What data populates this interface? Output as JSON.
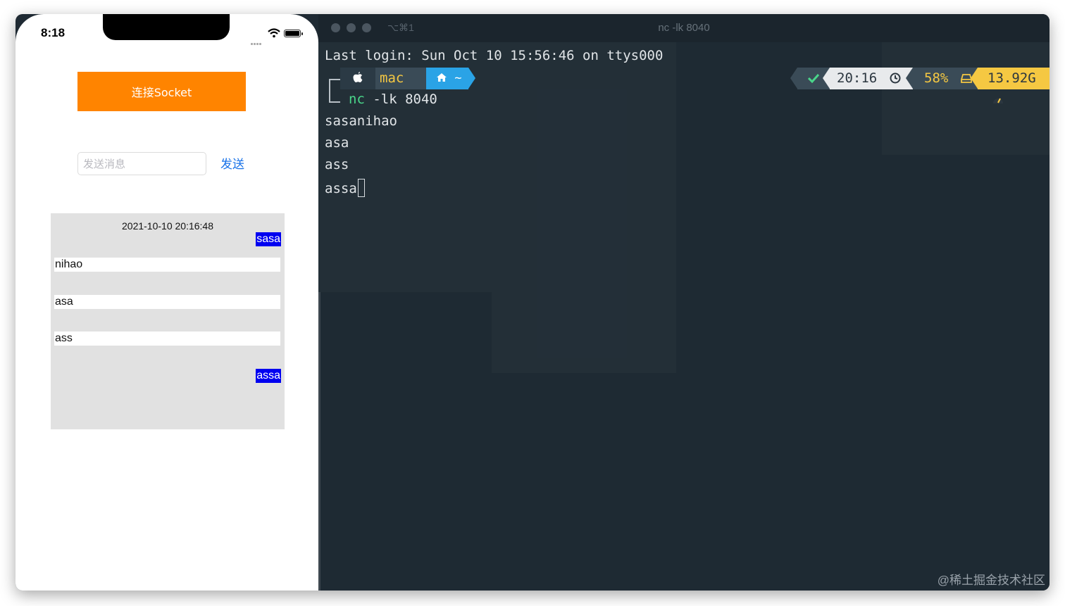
{
  "terminal": {
    "shortcut": "⌥⌘1",
    "title": "nc -lk 8040",
    "last_login": "Last login: Sun Oct 10 15:56:46 on ttys000",
    "prompt": {
      "user_segment": "mac",
      "dir_segment": "~",
      "cmd_name": "nc",
      "cmd_args": " -lk 8040"
    },
    "status": {
      "time": "20:16",
      "battery": "58%",
      "memory": "13.92G"
    },
    "output_lines": [
      "sasanihao",
      "asa",
      "ass"
    ],
    "current_line": "assa",
    "colors": {
      "background": "#1e2a33",
      "accent_yellow": "#f5c842",
      "accent_blue": "#2aa3e6",
      "accent_green": "#4ad68a"
    }
  },
  "phone": {
    "status_time": "8:18",
    "connect_label": "连接Socket",
    "input_placeholder": "发送消息",
    "input_value": "",
    "send_label": "发送",
    "chat": {
      "timestamp": "2021-10-10 20:16:48",
      "messages": [
        {
          "side": "sent",
          "text": "sasa"
        },
        {
          "side": "received",
          "text": "nihao"
        },
        {
          "side": "received",
          "text": "asa"
        },
        {
          "side": "received",
          "text": "ass"
        },
        {
          "side": "sent",
          "text": "assa"
        }
      ]
    },
    "colors": {
      "connect_button": "#ff8400",
      "send_link": "#1a73e8",
      "sent_bubble": "#0000f0",
      "chat_background": "#e1e1e1"
    }
  },
  "watermark": "@稀土掘金技术社区"
}
